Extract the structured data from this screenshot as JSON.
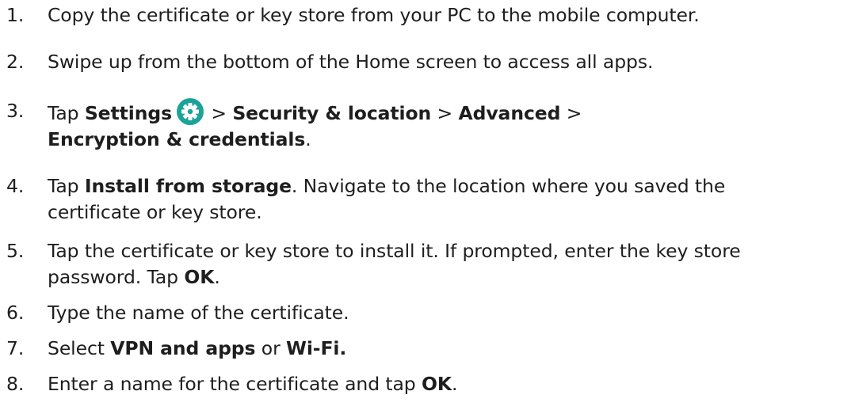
{
  "steps": [
    {
      "number": "1.",
      "text": "Copy the certificate or key store from your PC to the mobile computer."
    },
    {
      "number": "2.",
      "text": "Swipe up from the bottom of the Home screen to access all apps."
    },
    {
      "number": "3.",
      "tap": "Tap ",
      "settings": "Settings",
      "sep1": " > ",
      "security": "Security & location",
      "sep2": " > ",
      "advanced": "Advanced",
      "sep3": " >",
      "encryption": "Encryption & credentials",
      "end": "."
    },
    {
      "number": "4.",
      "tap": "Tap ",
      "install": "Install from storage",
      "rest1": ". Navigate to the location where you saved the",
      "rest2": "certificate or key store."
    },
    {
      "number": "5.",
      "line1": "Tap the certificate or key store to install it. If prompted, enter the key store",
      "line2a": "password. Tap ",
      "ok": "OK",
      "end": "."
    },
    {
      "number": "6.",
      "text": "Type the name of the certificate."
    },
    {
      "number": "7.",
      "select": "Select ",
      "vpn": "VPN and apps",
      "or": " or ",
      "wifi": "Wi-Fi."
    },
    {
      "number": "8.",
      "text": "Enter a name for the certificate and tap ",
      "ok": "OK",
      "end": "."
    }
  ],
  "icons": {
    "settings_icon": "gear-icon",
    "settings_icon_color": "#1aa39a"
  }
}
